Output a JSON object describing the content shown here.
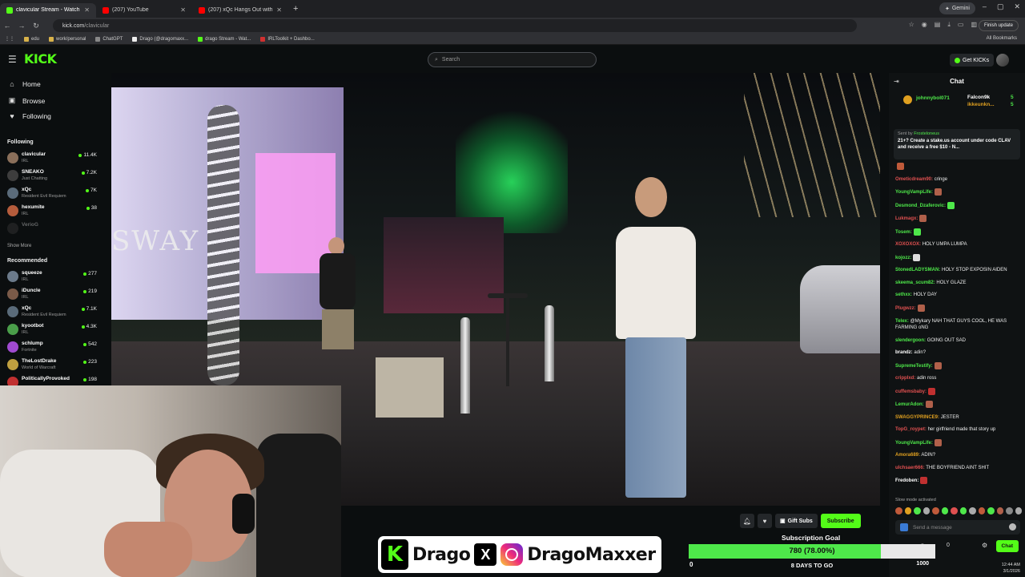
{
  "browser": {
    "tabs": [
      {
        "title": "clavicular Stream - Watch L",
        "color": "#53fc18",
        "active": true
      },
      {
        "title": "(207) YouTube",
        "color": "#ff0000",
        "active": false
      },
      {
        "title": "(207) xQc Hangs Out with Strea",
        "color": "#ff0000",
        "active": false
      }
    ],
    "gemini_label": "Gemini",
    "url_host": "kick.com",
    "url_path": "/clavicular",
    "finish_update": "Finish update",
    "bookmarks": [
      "edu",
      "work/personal",
      "ChatGPT",
      "Drago (@dragomaxx...",
      "drago Stream - Wat...",
      "IRLToolkit + Dashbo..."
    ],
    "all_bookmarks": "All Bookmarks"
  },
  "header": {
    "logo": "KICK",
    "search_placeholder": "Search",
    "get_kicks": "Get KICKs"
  },
  "sidebar": {
    "nav": [
      {
        "label": "Home",
        "icon": "home-icon",
        "glyph": "⌂"
      },
      {
        "label": "Browse",
        "icon": "browse-icon",
        "glyph": "▣"
      },
      {
        "label": "Following",
        "icon": "heart-icon",
        "glyph": "♥"
      }
    ],
    "following_title": "Following",
    "following": [
      {
        "name": "clavicular",
        "category": "IRL",
        "viewers": "11.4K",
        "color": "#8a6f5a"
      },
      {
        "name": "SNEAKO",
        "category": "Just Chatting",
        "viewers": "7.2K",
        "color": "#3d3d3d"
      },
      {
        "name": "xQc",
        "category": "Resident Evil Requiem",
        "viewers": "7K",
        "color": "#5a6b7a"
      },
      {
        "name": "hexumite",
        "category": "IRL",
        "viewers": "38",
        "color": "#b55c3c"
      },
      {
        "name": "VerioG",
        "category": "",
        "viewers": "",
        "color": "#444"
      }
    ],
    "show_more": "Show More",
    "recommended_title": "Recommended",
    "recommended": [
      {
        "name": "squeeze",
        "category": "IRL",
        "viewers": "277",
        "color": "#6b7a8a"
      },
      {
        "name": "iDuncle",
        "category": "IRL",
        "viewers": "219",
        "color": "#7a5a48"
      },
      {
        "name": "xQc",
        "category": "Resident Evil Requiem",
        "viewers": "7.1K",
        "color": "#5a6b7a"
      },
      {
        "name": "kyootbot",
        "category": "IRL",
        "viewers": "4.3K",
        "color": "#4a9e4a"
      },
      {
        "name": "schlump",
        "category": "Fortnite",
        "viewers": "542",
        "color": "#a04ad0"
      },
      {
        "name": "TheLostDrake",
        "category": "World of Warcraft",
        "viewers": "223",
        "color": "#c0a040"
      },
      {
        "name": "PoliticallyProvoked",
        "category": "",
        "viewers": "198",
        "color": "#c03030"
      }
    ]
  },
  "video": {
    "sign_text": "SWAY"
  },
  "chat": {
    "title": "Chat",
    "gifters": [
      {
        "name": "johnnybol071",
        "color": "#4ee84a"
      },
      {
        "name": "Falcon9k",
        "color": "#ffffff",
        "count": "5"
      },
      {
        "name": "ikkeunkn...",
        "color": "#e0a020",
        "count": "5"
      }
    ],
    "pinned_by": "Sent by",
    "pinned_user": "Frosteloneus",
    "pinned_text": "21+? Create a stake.us account under code CLAV and receive a free $10 - N...",
    "messages": [
      {
        "user": "",
        "text": "",
        "color": "#e05050",
        "emote": "#c05a3a"
      },
      {
        "user": "Ometicdream90:",
        "text": "cringe",
        "color": "#e05050"
      },
      {
        "user": "YoungVampLife:",
        "text": "",
        "color": "#4ee84a",
        "emote": "#b0604a"
      },
      {
        "user": "Desmond_Dzaferovic:",
        "text": "",
        "color": "#4ee84a",
        "emote": "#4ee84a"
      },
      {
        "user": "Lukmagx:",
        "text": "",
        "color": "#e05050",
        "emote": "#b0604a"
      },
      {
        "user": "Tosem:",
        "text": "",
        "color": "#4ee84a",
        "emote": "#4ee84a"
      },
      {
        "user": "XOXOXOX:",
        "text": "HOLY UMPA LUMPA",
        "color": "#e05050"
      },
      {
        "user": "kojozz:",
        "text": "",
        "color": "#4ee84a",
        "emote": "#dddddd"
      },
      {
        "user": "StonedLADYSMAN:",
        "text": "HOLY STOP EXPOSIN AIDEN",
        "color": "#4ee84a"
      },
      {
        "user": "skeema_scum82:",
        "text": "HOLY GLAZE",
        "color": "#4ee84a"
      },
      {
        "user": "sethxx:",
        "text": "HOLY DAY",
        "color": "#4ee84a"
      },
      {
        "user": "Plugwzz:",
        "text": "",
        "color": "#e05050",
        "emote": "#b0604a"
      },
      {
        "user": "Telex:",
        "text": "@Mykary NAH THAT GUYS COOL, HE WAS FARMING oNG",
        "color": "#4ee84a"
      },
      {
        "user": "slendergoon:",
        "text": "GOING OUT SAD",
        "color": "#4ee84a"
      },
      {
        "user": "brandz:",
        "text": "adin?",
        "color": "#ffffff"
      },
      {
        "user": "SupremeTestify:",
        "text": "",
        "color": "#4ee84a",
        "emote": "#b0604a"
      },
      {
        "user": "cripplxd:",
        "text": "adin ross",
        "color": "#e05050"
      },
      {
        "user": "cuffemsbaby:",
        "text": "",
        "color": "#e05050",
        "emote": "#c03030"
      },
      {
        "user": "LemurAdon:",
        "text": "",
        "color": "#4ee84a",
        "emote": "#b0604a"
      },
      {
        "user": "SWAGGYPRINCE9:",
        "text": "JESTER",
        "color": "#e0a020"
      },
      {
        "user": "TopG_roypet:",
        "text": "her girlfriend made that story up",
        "color": "#e05050"
      },
      {
        "user": "YoungVampLife:",
        "text": "",
        "color": "#4ee84a",
        "emote": "#b0604a"
      },
      {
        "user": "Amora689:",
        "text": "ADIN?",
        "color": "#e0a020"
      },
      {
        "user": "ulchsaer666:",
        "text": "THE BOYFRIEND AINT SHIT",
        "color": "#e05050"
      },
      {
        "user": "Fredoben:",
        "text": "",
        "color": "#ffffff",
        "emote": "#c03030"
      }
    ],
    "slow_mode": "Slow mode activated",
    "input_placeholder": "Send a message",
    "kick_count": "0",
    "chat_button": "Chat"
  },
  "actions": {
    "gift_subs": "Gift Subs",
    "subscribe": "Subscribe"
  },
  "banner": {
    "k_letter": "K",
    "kick_name": "Drago",
    "x_letter": "X",
    "ig_name": "DragoMaxxer"
  },
  "sub_goal": {
    "title": "Subscription Goal",
    "value_text": "780 (78.00%)",
    "progress_percent": 78,
    "min": "0",
    "max": "1000",
    "days": "8 DAYS TO GO"
  },
  "tray": {
    "time": "12:44 AM",
    "date": "3/1/2026"
  }
}
